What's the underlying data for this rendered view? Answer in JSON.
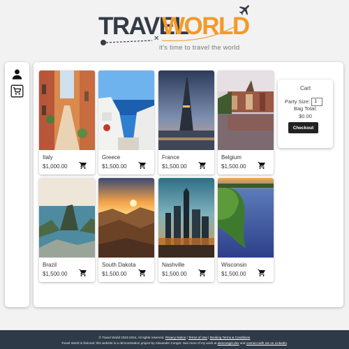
{
  "logo": {
    "word1": "TRAVEL",
    "word2": "WORLD",
    "x_mark": "✕",
    "tagline": "it's time to travel the world",
    "icon": "airplane-icon"
  },
  "sidebar": {
    "items": [
      {
        "icon": "user-icon"
      },
      {
        "icon": "shopping-cart-icon"
      }
    ]
  },
  "destinations": [
    {
      "name": "Italy",
      "price": "$1,000.00",
      "image": "italy-street-photo"
    },
    {
      "name": "Greece",
      "price": "$1,500.00",
      "image": "greece-coast-photo"
    },
    {
      "name": "France",
      "price": "$1,500.00",
      "image": "paris-eiffel-tower-photo"
    },
    {
      "name": "Belgium",
      "price": "$1,500.00",
      "image": "belgium-canal-photo"
    },
    {
      "name": "Brazil",
      "price": "$1,500.00",
      "image": "rio-de-janeiro-photo"
    },
    {
      "name": "South Dakota",
      "price": "$1,500.00",
      "image": "badlands-sunset-photo"
    },
    {
      "name": "Nashville",
      "price": "$1,500.00",
      "image": "nashville-skyline-photo"
    },
    {
      "name": "Wisconsin",
      "price": "$1,500.00",
      "image": "wisconsin-lake-photo"
    }
  ],
  "cart": {
    "title": "Cart",
    "party_size_label": "Party Size:",
    "party_size_value": "1",
    "bag_total_label": "Bag Total:",
    "bag_total_value": "$0.00",
    "checkout_label": "Checkout"
  },
  "footer": {
    "copyright": "© Travel World 2023-2024, All rights reserved.",
    "privacy": "Privacy Notice",
    "sep1": " | ",
    "terms": "Terms of Use",
    "sep2": " | ",
    "booking": "Booking Terms & Conditions",
    "disclaimer": "Travel World is fictional; this website is a demonstration project by Alexander Conger. See more of my work at ",
    "site": "alexconger.dev",
    "and": " and ",
    "linkedin": "connect with me on LinkedIn",
    "end": "."
  },
  "colors": {
    "brand_dark": "#343a46",
    "brand_orange": "#f39a2b",
    "footer_bg": "#2f3a48",
    "button_bg": "#222222"
  }
}
